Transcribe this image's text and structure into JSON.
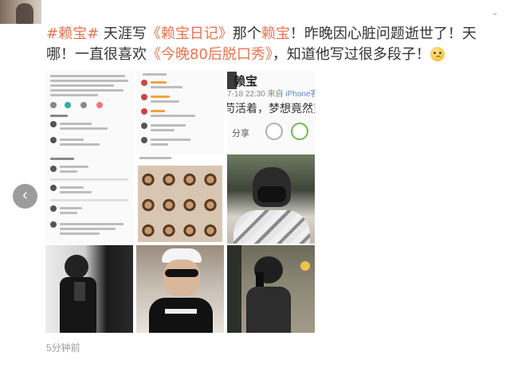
{
  "post": {
    "hashtag": "#赖宝#",
    "t1": " 天涯写",
    "diary": "《赖宝日记》",
    "t2": "那个",
    "name": "赖宝",
    "t3": "！昨晚因心脏问题逝世了！天哪！一直很喜欢",
    "show": "《今晚80后脱口秀》",
    "t4": "，知道他写过很多段子！"
  },
  "timestamp": "5分钟前",
  "screenshot_b": {
    "name": "赖宝",
    "meta_time": "7-18 22:30 来自 ",
    "meta_source": "iPhone客",
    "text": "苟活着，梦想竟然变成了就",
    "share_label": "分享"
  },
  "icons": {
    "prev_arrow": "chevron-left-icon",
    "menu": "chevron-down-icon",
    "emoji": "sad-face-emoji"
  },
  "colors": {
    "link": "#eb7350",
    "text": "#333333",
    "muted": "#999999"
  }
}
